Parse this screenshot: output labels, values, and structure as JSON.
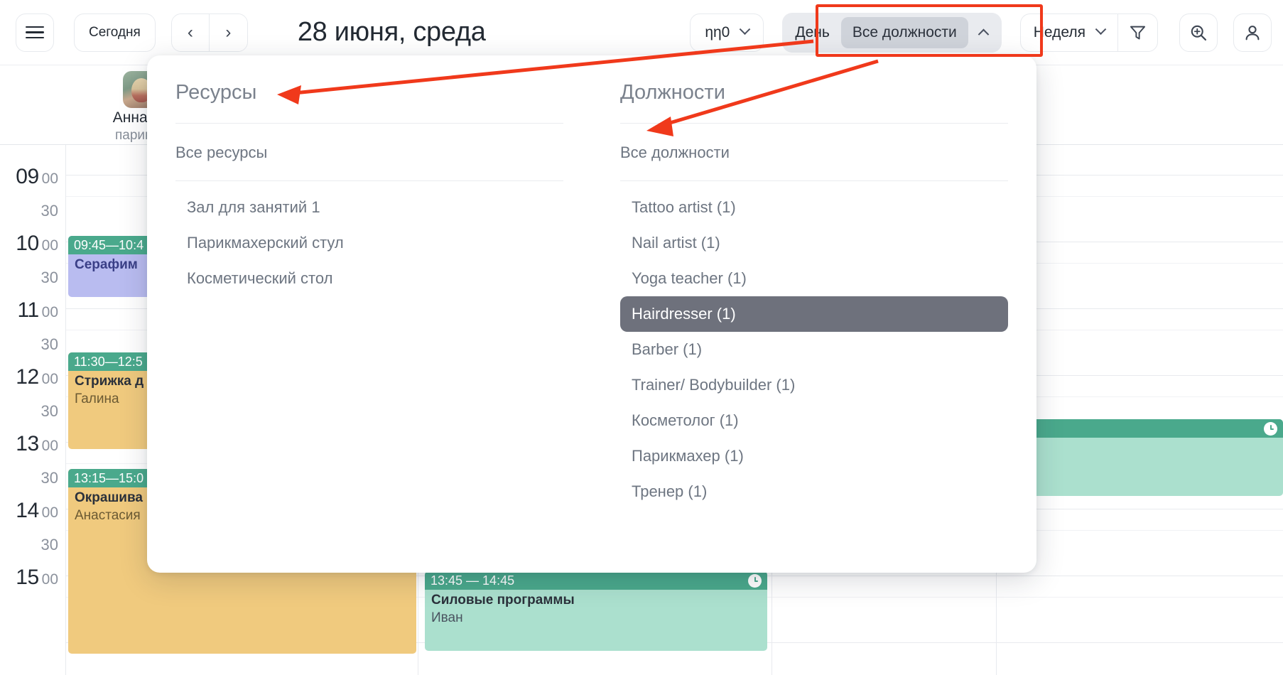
{
  "topbar": {
    "menu_icon": "hamburger-menu-icon",
    "today_label": "Сегодня",
    "prev_label": "‹",
    "next_label": "›",
    "page_title": "28 июня, среда",
    "branch_select_value": "ηη0",
    "segmented": {
      "mode_label": "День",
      "active_label": "Все должности",
      "caret": "chevron-up-icon"
    },
    "view_select_value": "Неделя",
    "filter_icon": "funnel-filter-icon",
    "zoom_icon": "zoom-in-icon",
    "user_icon": "user-account-icon"
  },
  "panel": {
    "resources": {
      "header": "Ресурсы",
      "all_label": "Все ресурсы",
      "items": [
        {
          "label": "Зал для занятий 1"
        },
        {
          "label": "Парикмахерский стул"
        },
        {
          "label": "Косметический стол"
        }
      ]
    },
    "positions": {
      "header": "Должности",
      "all_label": "Все должности",
      "items": [
        {
          "label": "Tattoo artist (1)",
          "selected": false
        },
        {
          "label": "Nail artist (1)",
          "selected": false
        },
        {
          "label": "Yoga teacher (1)",
          "selected": false
        },
        {
          "label": "Hairdresser (1)",
          "selected": true
        },
        {
          "label": "Barber (1)",
          "selected": false
        },
        {
          "label": "Trainer/ Bodybuilder (1)",
          "selected": false
        },
        {
          "label": "Косметолог (1)",
          "selected": false
        },
        {
          "label": "Парикмахер (1)",
          "selected": false
        },
        {
          "label": "Тренер (1)",
          "selected": false
        }
      ]
    }
  },
  "calendar": {
    "staff": [
      {
        "name": "Анна Ва",
        "role": "парикма"
      }
    ],
    "time_rows": [
      {
        "hour": "09",
        "min": "00",
        "half": "30"
      },
      {
        "hour": "10",
        "min": "00",
        "half": "30"
      },
      {
        "hour": "11",
        "min": "00",
        "half": "30"
      },
      {
        "hour": "12",
        "min": "00",
        "half": "30"
      },
      {
        "hour": "13",
        "min": "00",
        "half": "30"
      },
      {
        "hour": "14",
        "min": "00",
        "half": "30"
      },
      {
        "hour": "15",
        "min": "00",
        "half": ""
      }
    ],
    "events": [
      {
        "time": "09:45—10:4",
        "title": "Серафим",
        "sub": "",
        "body_color": "#b9bcf0",
        "text_color": "#3a3f87"
      },
      {
        "time": "11:30—12:5",
        "title": "Стрижка д",
        "sub": "Галина",
        "body_color": "#f0ca7e",
        "text_color": "#2b313b"
      },
      {
        "time": "13:15—15:0",
        "title": "Окрашива",
        "sub": "Анастасия",
        "body_color": "#f0ca7e",
        "text_color": "#2b313b"
      },
      {
        "time": "13:45 — 14:45",
        "title": "Силовые программы",
        "sub": "Иван",
        "body_color": "#abe0ce",
        "text_color": "#2b313b"
      },
      {
        "time": "",
        "title": "",
        "sub": "",
        "body_color": "#abe0ce",
        "text_color": "#2b313b"
      }
    ]
  },
  "colors": {
    "annotation": "#f0391b",
    "event_header": "#4aa98c",
    "selected_row": "#6e717c"
  }
}
